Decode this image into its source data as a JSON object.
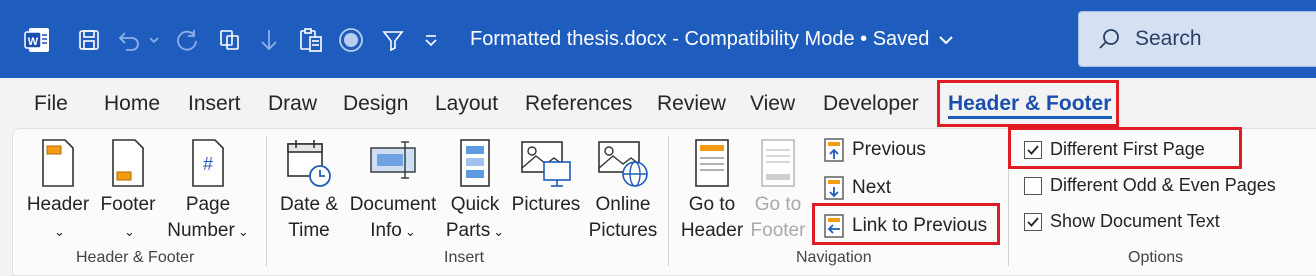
{
  "titlebar": {
    "doc_title": "Formatted thesis.docx  -  Compatibility Mode • Saved",
    "search_label": "Search",
    "icons": [
      "word-app-icon",
      "save-icon",
      "undo-icon",
      "redo-icon",
      "copy-icon",
      "arrow-down-icon",
      "clipboard-icon",
      "record-icon",
      "filter-icon",
      "customize-quick-access-icon"
    ],
    "bg_color": "#1e5cbd"
  },
  "tabs": {
    "file": "File",
    "home": "Home",
    "insert": "Insert",
    "draw": "Draw",
    "design": "Design",
    "layout": "Layout",
    "references": "References",
    "review": "Review",
    "view": "View",
    "developer": "Developer",
    "header_footer": "Header & Footer"
  },
  "ribbon": {
    "header_footer_group": {
      "label": "Header & Footer",
      "header": "Header",
      "footer": "Footer",
      "page_line1": "Page",
      "page_line2": "Number"
    },
    "insert_group": {
      "label": "Insert",
      "datetime_line1": "Date &",
      "datetime_line2": "Time",
      "docinfo_line1": "Document",
      "docinfo_line2": "Info",
      "quickparts_line1": "Quick",
      "quickparts_line2": "Parts",
      "pictures": "Pictures",
      "online_line1": "Online",
      "online_line2": "Pictures"
    },
    "navigation_group": {
      "label": "Navigation",
      "goto_header_line1": "Go to",
      "goto_header_line2": "Header",
      "goto_footer_line1": "Go to",
      "goto_footer_line2": "Footer",
      "previous": "Previous",
      "next": "Next",
      "link_previous": "Link to Previous"
    },
    "options_group": {
      "label": "Options",
      "different_first": "Different First Page",
      "different_odd_even": "Different Odd & Even Pages",
      "show_document_text": "Show Document Text"
    }
  }
}
